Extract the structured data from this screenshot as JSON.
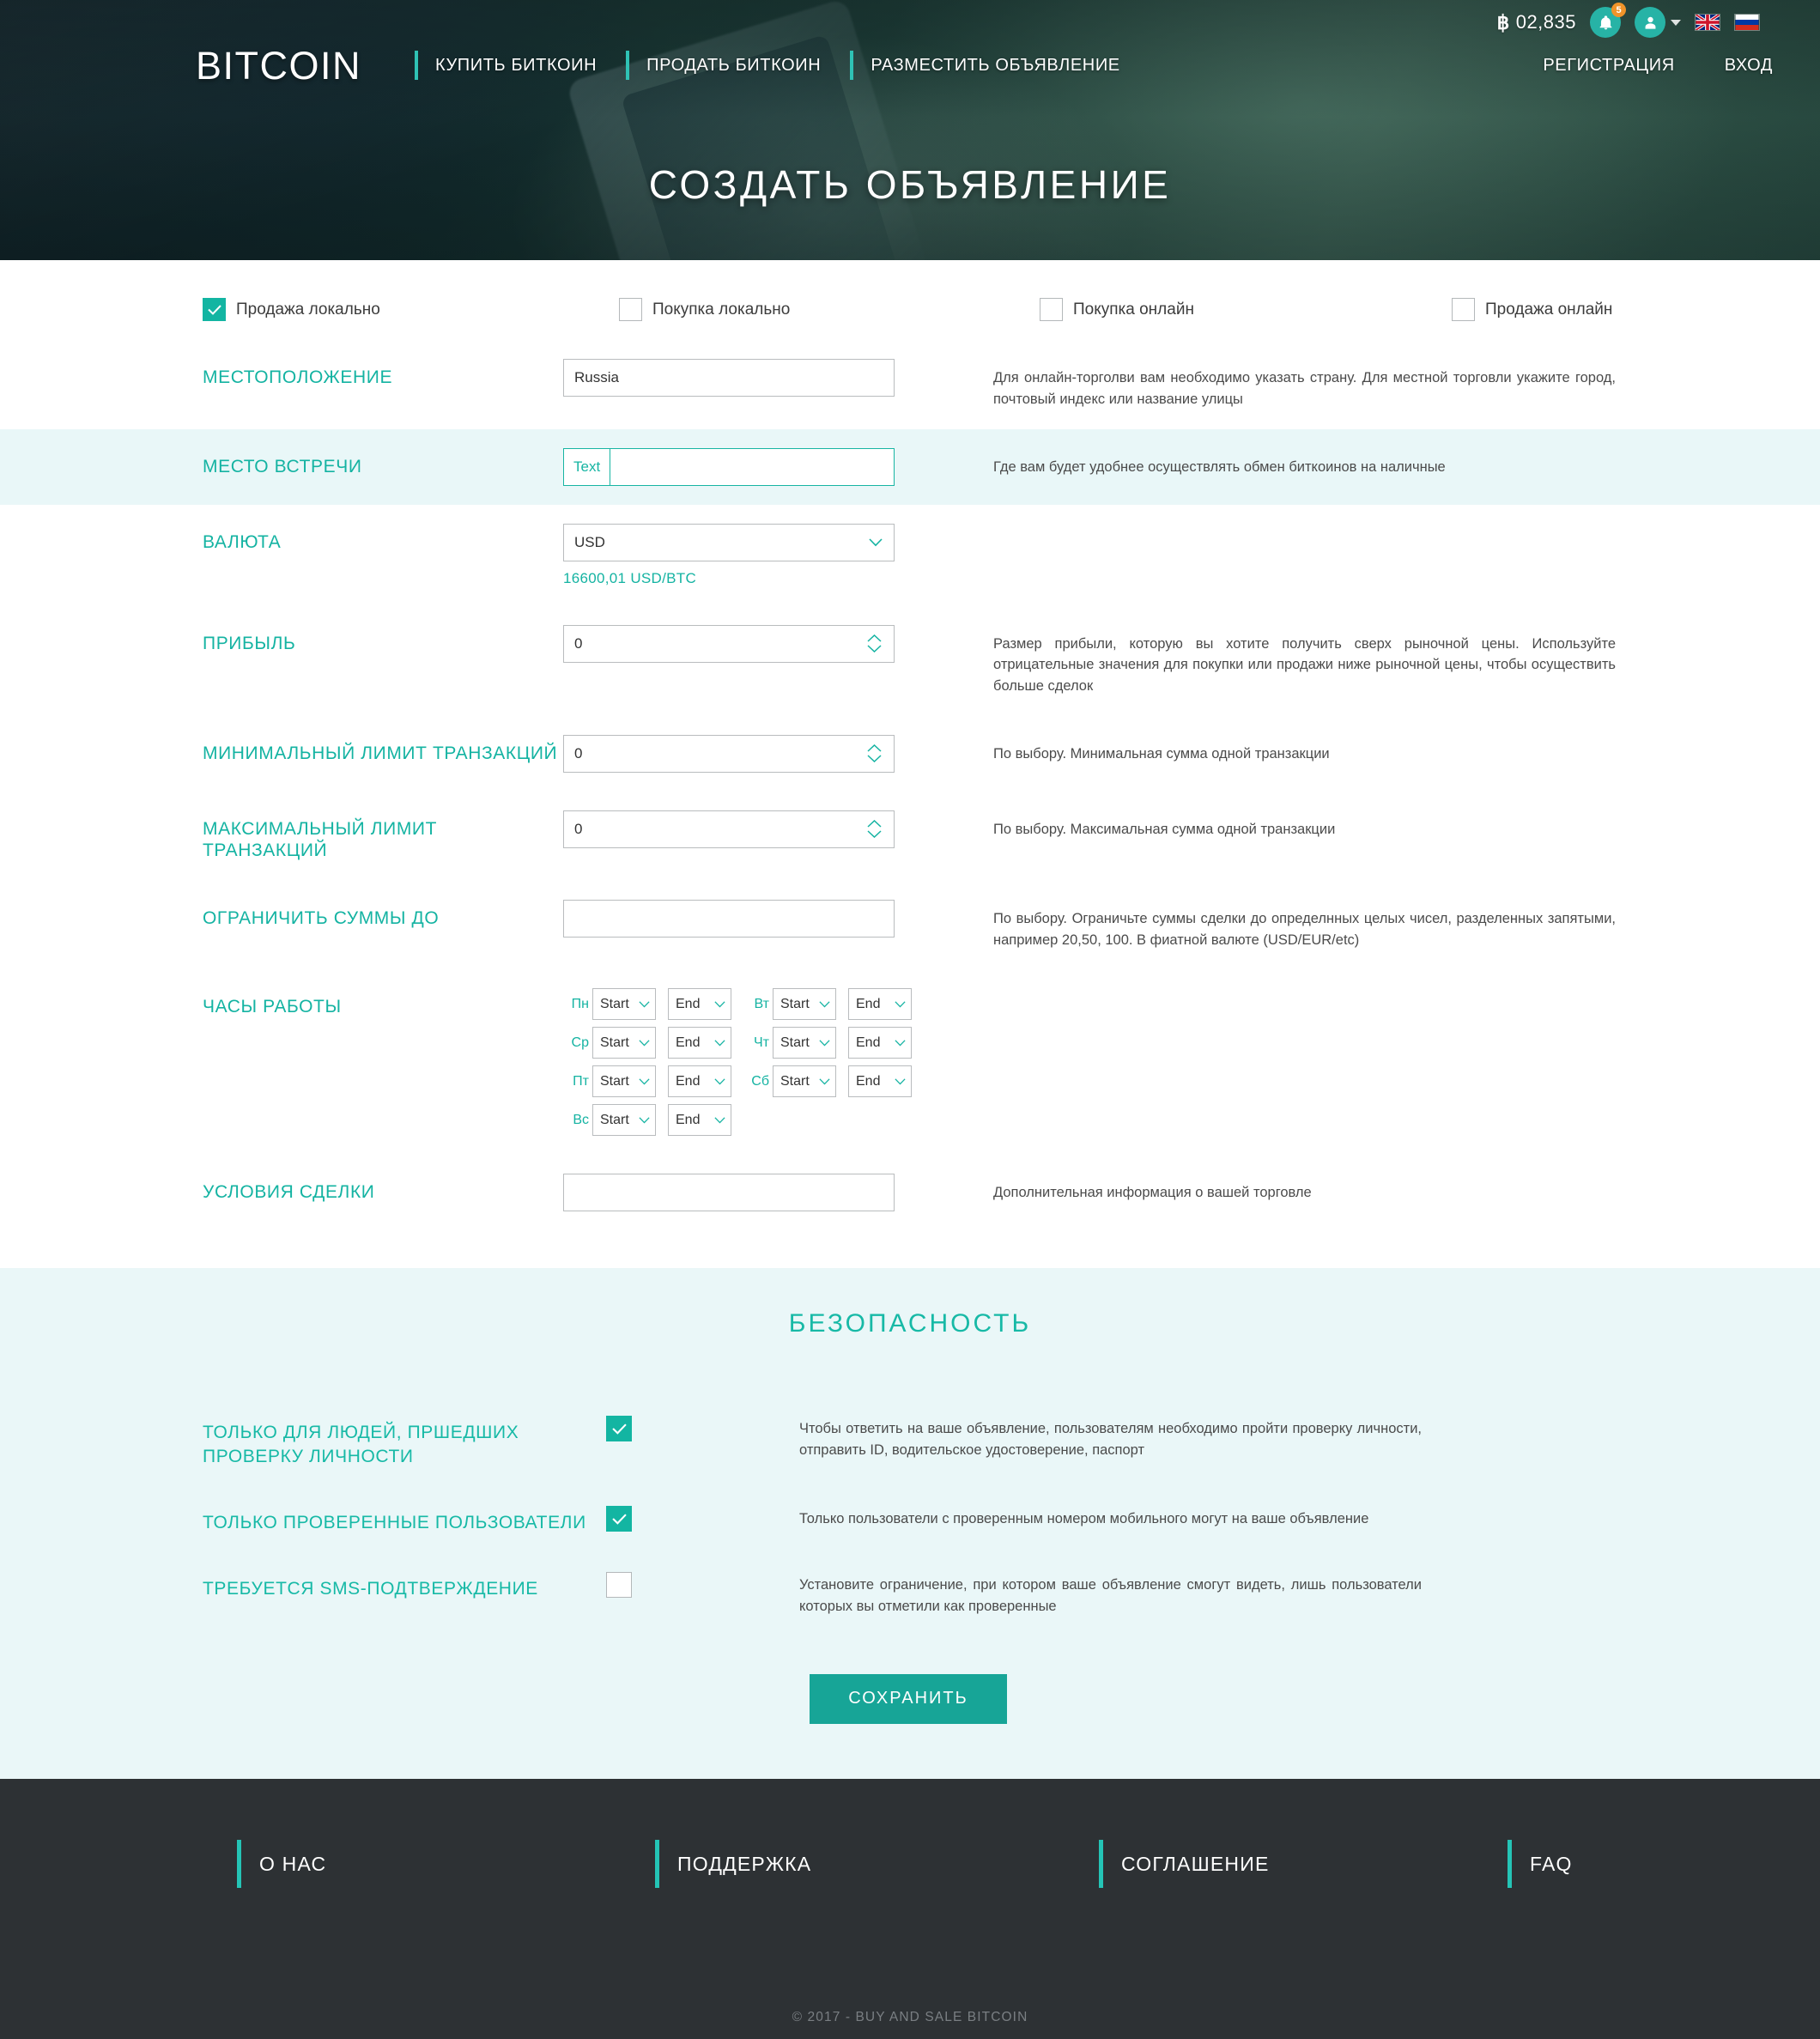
{
  "header": {
    "brand": "BITCOIN",
    "btc_symbol": "฿",
    "btc_balance": "02,835",
    "notification_count": "5",
    "nav": [
      {
        "label": "КУПИТЬ БИТКОИН"
      },
      {
        "label": "ПРОДАТЬ  БИТКОИН"
      },
      {
        "label": "РАЗМЕСТИТЬ ОБЪЯВЛЕНИЕ"
      }
    ],
    "nav_right": [
      {
        "label": "РЕГИСТРАЦИЯ"
      },
      {
        "label": "ВХОД"
      }
    ],
    "languages": [
      {
        "name": "english-flag"
      },
      {
        "name": "russian-flag"
      }
    ],
    "page_title": "СОЗДАТЬ ОБЪЯВЛЕНИЕ"
  },
  "trade_type": [
    {
      "label": "Продажа локально",
      "checked": true
    },
    {
      "label": "Покупка локально",
      "checked": false
    },
    {
      "label": "Покупка онлайн",
      "checked": false
    },
    {
      "label": "Продажа онлайн",
      "checked": false
    }
  ],
  "form": {
    "location": {
      "label": "МЕСТОПОЛОЖЕНИЕ",
      "value": "Russia",
      "placeholder": "",
      "desc": "Для онлайн-торголви вам необходимо указать страну. Для местной торговли укажите город, почтовый индекс или название улицы"
    },
    "meeting_place": {
      "label": "МЕСТО ВСТРЕЧИ",
      "prefix": "Text",
      "value": "",
      "placeholder": "",
      "desc": "Где вам будет удобнее осуществлять обмен биткоинов на наличные"
    },
    "currency": {
      "label": "ВАЛЮТА",
      "value": "USD",
      "rate": "16600,01 USD/BTC"
    },
    "profit": {
      "label": "ПРИБЫЛЬ",
      "value": "0",
      "desc": "Размер прибыли, которую вы хотите получить сверх рыночной цены. Используйте отрицательные значения для покупки или продажи ниже рыночной цены, чтобы осуществить больше сделок"
    },
    "min_limit": {
      "label": "МИНИМАЛЬНЫЙ ЛИМИТ ТРАНЗАКЦИЙ",
      "value": "0",
      "desc": "По выбору. Минимальная сумма одной транзакции"
    },
    "max_limit": {
      "label": "МАКСИМАЛЬНЫЙ ЛИМИТ ТРАНЗАКЦИЙ",
      "value": "0",
      "desc": "По выбору. Максимальная сумма одной транзакции"
    },
    "round_amounts": {
      "label": "ОГРАНИЧИТЬ СУММЫ ДО",
      "value": "",
      "placeholder": "",
      "desc": "По выбору. Ограничьте   суммы сделки до определнных целых чисел, разделенных запятыми, например 20,50, 100. В фиатной валюте (USD/EUR/etc)"
    },
    "working_hours": {
      "label": "ЧАСЫ РАБОТЫ",
      "start_label": "Start",
      "end_label": "End",
      "days": [
        {
          "short": "Пн",
          "start": "Start",
          "end": "End"
        },
        {
          "short": "Вт",
          "start": "Start",
          "end": "End"
        },
        {
          "short": "Ср",
          "start": "Start",
          "end": "End"
        },
        {
          "short": "Чт",
          "start": "Start",
          "end": "End"
        },
        {
          "short": "Пт",
          "start": "Start",
          "end": "End"
        },
        {
          "short": "Сб",
          "start": "Start",
          "end": "End"
        },
        {
          "short": "Вс",
          "start": "Start",
          "end": "End"
        }
      ]
    },
    "terms": {
      "label": "УСЛОВИЯ СДЕЛКИ",
      "value": "",
      "desc": "Дополнительная информация о вашей торговле"
    }
  },
  "security": {
    "title": "БЕЗОПАСНОСТЬ",
    "rows": [
      {
        "label": "ТОЛЬКО ДЛЯ ЛЮДЕЙ, ПРШЕДШИХ ПРОВЕРКУ ЛИЧНОСТИ",
        "checked": true,
        "desc": "Чтобы ответить на ваше объявление, пользователям необходимо пройти проверку личности, отправить ID, водительское удостоверение, паспорт"
      },
      {
        "label": "ТОЛЬКО ПРОВЕРЕННЫЕ ПОЛЬЗОВАТЕЛИ",
        "checked": true,
        "desc": "Только пользователи с проверенным номером мобильного могут на ваше объявление"
      },
      {
        "label": "ТРЕБУЕТСЯ SMS-ПОДТВЕРЖДЕНИЕ",
        "checked": false,
        "desc": "Установите ограничение, при котором ваше объявление смогут видеть, лишь пользователи которых вы отметили как проверенные"
      }
    ],
    "save_label": "СОХРАНИТЬ"
  },
  "footer": {
    "links": [
      {
        "label": "О НАС"
      },
      {
        "label": "ПОДДЕРЖКА"
      },
      {
        "label": "СОГЛАШЕНИЕ"
      },
      {
        "label": "FAQ"
      }
    ],
    "copyright": "© 2017 - BUY AND SALE BITCOIN"
  },
  "colors": {
    "accent": "#14b3a2",
    "accent_bright": "#2fc2b5",
    "badge": "#f0942a",
    "footer_bg": "#2d3134",
    "security_bg": "#eaf7f8"
  }
}
